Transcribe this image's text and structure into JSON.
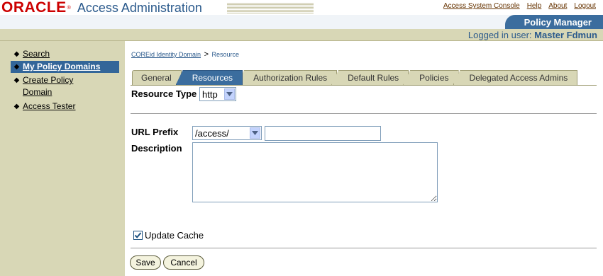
{
  "header": {
    "logo": "ORACLE",
    "logo_mark": "®",
    "app_title": "Access Administration",
    "links": [
      "Access System Console",
      "Help",
      "About",
      "Logout"
    ],
    "active_app_tab": "Policy Manager",
    "logged_in_prefix": "Logged in user:",
    "logged_in_user": "Master Fdmun"
  },
  "nav": {
    "items": [
      {
        "label": "Search",
        "selected": false
      },
      {
        "label": "My Policy Domains",
        "selected": true
      },
      {
        "label": "Create Policy Domain",
        "selected": false
      },
      {
        "label": "Access Tester",
        "selected": false
      }
    ],
    "bullet": "◆"
  },
  "breadcrumb": {
    "parent": "COREid Identity Domain",
    "separator": ">",
    "current": "Resource"
  },
  "tabs": [
    {
      "label": "General",
      "active": false
    },
    {
      "label": "Resources",
      "active": true
    },
    {
      "label": "Authorization Rules",
      "active": false
    },
    {
      "label": "Default Rules",
      "active": false
    },
    {
      "label": "Policies",
      "active": false
    },
    {
      "label": "Delegated Access Admins",
      "active": false
    }
  ],
  "form": {
    "resource_type_label": "Resource Type",
    "resource_type_value": "http",
    "url_prefix_label": "URL Prefix",
    "url_prefix_value": "/access/",
    "url_suffix_value": "",
    "description_label": "Description",
    "description_value": "",
    "update_cache_label": "Update Cache",
    "update_cache_checked": true
  },
  "buttons": {
    "save": "Save",
    "cancel": "Cancel"
  },
  "colors": {
    "oracle_red": "#cc0000",
    "header_blue": "#3b6d9e",
    "nav_bg": "#d8d7b6",
    "selected_nav": "#336699"
  }
}
